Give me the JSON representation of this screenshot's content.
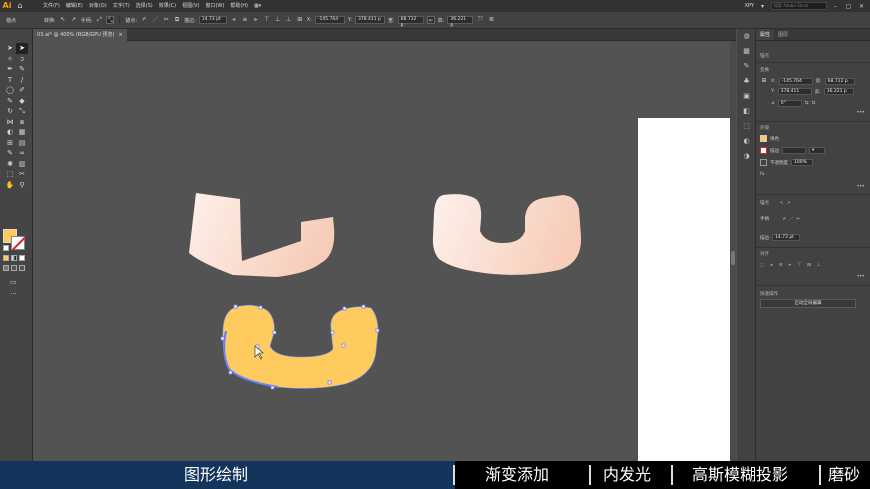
{
  "app": {
    "logo": "Ai",
    "workspace": "XPY",
    "search_placeholder": "搜索 Adobe Stock"
  },
  "menu": [
    "文件(F)",
    "编辑(E)",
    "对象(O)",
    "文字(T)",
    "选择(S)",
    "效果(C)",
    "视图(V)",
    "窗口(W)",
    "帮助(H)"
  ],
  "control_bar": {
    "label": "锚点",
    "convert": "转换:",
    "handles": "手柄:",
    "anchors": "锚点:",
    "stroke_label": "描边:",
    "stroke_value": "14.73 pt",
    "x_label": "X:",
    "x": "-145.764",
    "y_label": "Y:",
    "y": "378.411 p",
    "w_label": "宽:",
    "w": "68.712 p",
    "h_label": "高:",
    "h": "36.221 p"
  },
  "document_tab": {
    "title": "03.ai* @ 400% (RGB/GPU 预览)",
    "close": "×"
  },
  "panel": {
    "tabs": [
      "属性",
      "图层"
    ],
    "section_anchor": "锚点",
    "section_transform": "变换",
    "x_label": "X:",
    "x": "-145.764",
    "y_label": "Y:",
    "y": "378.411",
    "w_label": "宽:",
    "w": "68.712 p",
    "h_label": "高:",
    "h": "36.221 p",
    "rotate": "0°",
    "section_appearance": "外观",
    "fill": "填色",
    "stroke": "描边",
    "opacity": "不透明度",
    "opacity_value": "100%",
    "fx": "fx.",
    "section_anchors": "锚点",
    "handles_label": "手柄",
    "anchor_label": "锚点",
    "stroke_label": "描边",
    "stroke_value": "14.73 pt",
    "section_align": "对齐",
    "section_quick": "快速操作",
    "quick_btn": "启动全局编辑"
  },
  "caption": {
    "step1": "图形绘制",
    "step2": "渐变添加",
    "step3": "内发光",
    "step4": "高斯模糊投影",
    "step5": "磨砂"
  },
  "colors": {
    "fill_swatch": "#ffc95c",
    "shape_gradient_start": "#fdf1ec",
    "shape_gradient_end": "#f7cdb9",
    "selected_shape": "#ffca5e",
    "selection_accent": "#5c7cfa",
    "caption_blue": "#13355c"
  }
}
